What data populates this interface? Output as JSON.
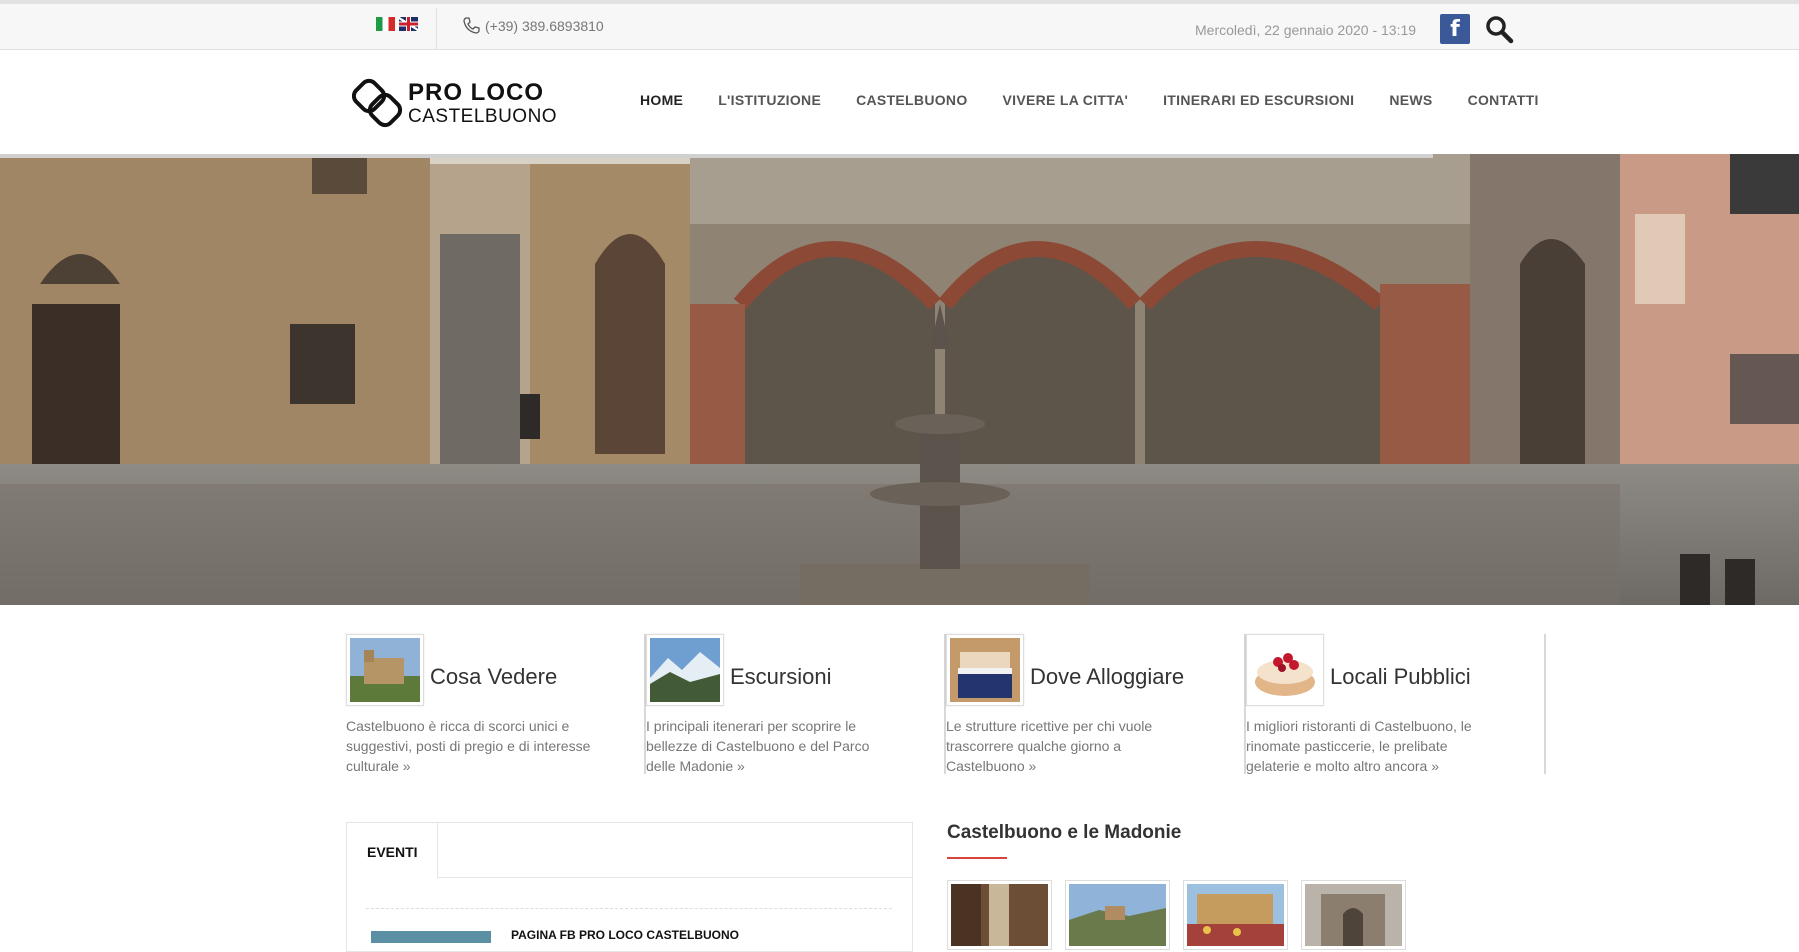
{
  "topbar": {
    "phone": "(+39) 389.6893810",
    "date": "Mercoledì, 22 gennaio 2020 - 13:19",
    "facebook_label": "f"
  },
  "logo": {
    "line1": "PRO LOCO",
    "line2": "CASTELBUONO"
  },
  "nav": {
    "items": [
      {
        "label": "HOME"
      },
      {
        "label": "L'ISTITUZIONE"
      },
      {
        "label": "CASTELBUONO"
      },
      {
        "label": "VIVERE LA CITTA'"
      },
      {
        "label": "ITINERARI ED ESCURSIONI"
      },
      {
        "label": "NEWS"
      },
      {
        "label": "CONTATTI"
      }
    ]
  },
  "features": [
    {
      "title": "Cosa Vedere",
      "desc": "Castelbuono è ricca di scorci unici e suggestivi, posti di pregio e di interesse culturale »"
    },
    {
      "title": "Escursioni",
      "desc": "I principali itenerari per scoprire le bellezze di Castelbuono e del Parco delle Madonie »"
    },
    {
      "title": "Dove Alloggiare",
      "desc": "Le strutture ricettive per chi vuole trascorrere qualche giorno a Castelbuono »"
    },
    {
      "title": "Locali Pubblici",
      "desc": "I migliori ristoranti di Castelbuono, le rinomate pasticcerie, le prelibate gelaterie e molto altro ancora »"
    }
  ],
  "events": {
    "tab_label": "EVENTI",
    "first_title": "PAGINA FB PRO LOCO CASTELBUONO"
  },
  "madonie": {
    "title": "Castelbuono e le Madonie"
  },
  "colors": {
    "accent": "#d9453b",
    "facebook": "#3b5998"
  }
}
